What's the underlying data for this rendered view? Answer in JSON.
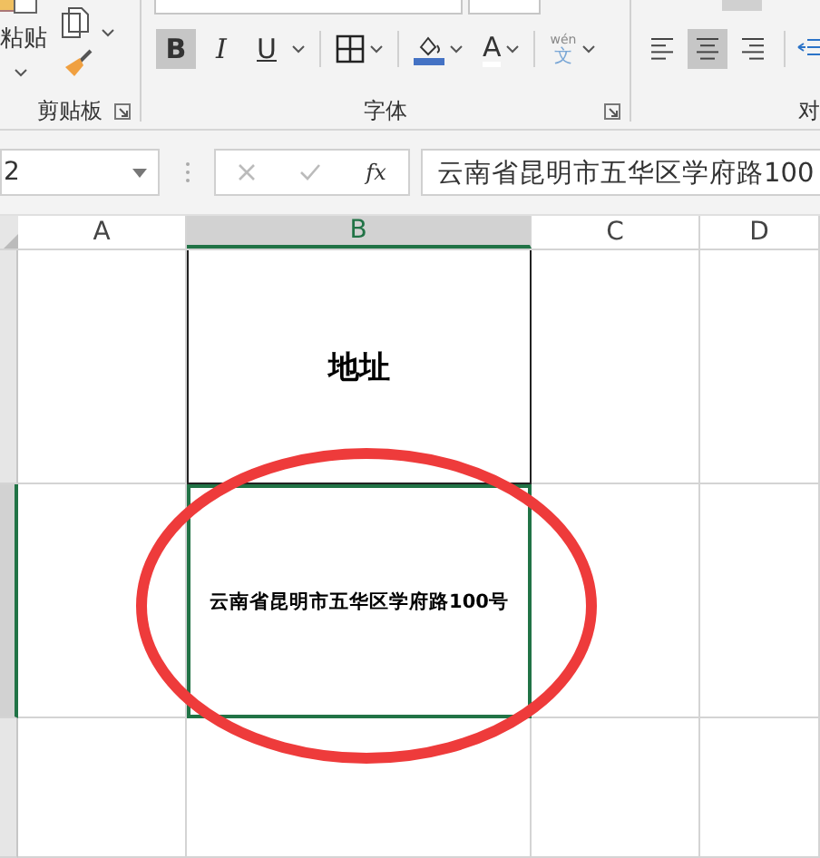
{
  "ribbon": {
    "clipboard": {
      "paste_label": "粘贴",
      "group_label": "剪贴板"
    },
    "font": {
      "group_label": "字体",
      "styles": [
        {
          "kind": "bold",
          "label": "B",
          "selected": true
        },
        {
          "kind": "italic",
          "label": "I",
          "selected": false
        },
        {
          "kind": "underline",
          "label": "U",
          "selected": false
        }
      ],
      "font_color_label": "A",
      "phonetic": {
        "top": "wén",
        "bottom": "文"
      }
    },
    "alignment": {
      "group_label": "对",
      "align": [
        {
          "kind": "left",
          "selected": false
        },
        {
          "kind": "center",
          "selected": true
        },
        {
          "kind": "right",
          "selected": false
        }
      ]
    }
  },
  "formula_bar": {
    "name_box": "2",
    "function_label": "fx",
    "value": "云南省昆明市五华区学府路100"
  },
  "sheet": {
    "columns": [
      {
        "label": "A",
        "selected": false
      },
      {
        "label": "B",
        "selected": true
      },
      {
        "label": "C",
        "selected": false
      },
      {
        "label": "D",
        "selected": false
      }
    ],
    "rows": [
      {
        "selected": false,
        "b_cell": {
          "kind": "heading",
          "text": "地址"
        }
      },
      {
        "selected": true,
        "b_cell": {
          "kind": "body",
          "text": "云南省昆明市五华区学府路100号"
        }
      },
      {
        "selected": false
      }
    ],
    "annotation": {
      "kind": "ellipse"
    }
  }
}
